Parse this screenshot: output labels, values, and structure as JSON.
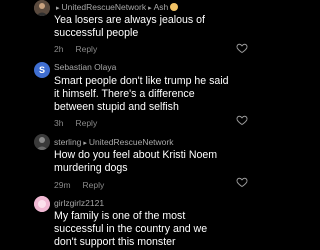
{
  "comments": [
    {
      "author": "",
      "reply_to": "UnitedRescueNetwork",
      "reply_to_sub": "Ash",
      "text": "Yea losers are always jealous of successful people",
      "time": "2h",
      "reply_label": "Reply"
    },
    {
      "author": "Sebastian Olaya",
      "text": "Smart people don't like trump he said it himself. There's a difference between stupid and selfish",
      "time": "3h",
      "reply_label": "Reply",
      "avatar_initial": "S",
      "avatar_color": "#3f6ed1"
    },
    {
      "author": "sterling",
      "reply_to": "UnitedRescueNetwork",
      "text": "How do you feel about Kristi Noem murdering dogs",
      "time": "29m",
      "reply_label": "Reply"
    },
    {
      "author": "girlzgirlz2121",
      "text": "My family is one of the most successful in the country and we don't support this monster",
      "avatar_color": "#e8a9c8"
    }
  ],
  "icons": {
    "like": "heart-outline-icon",
    "arrow": "triangle-right-icon"
  },
  "colors": {
    "background": "#000000",
    "text": "#ffffff",
    "secondary": "#a8a8a8"
  }
}
